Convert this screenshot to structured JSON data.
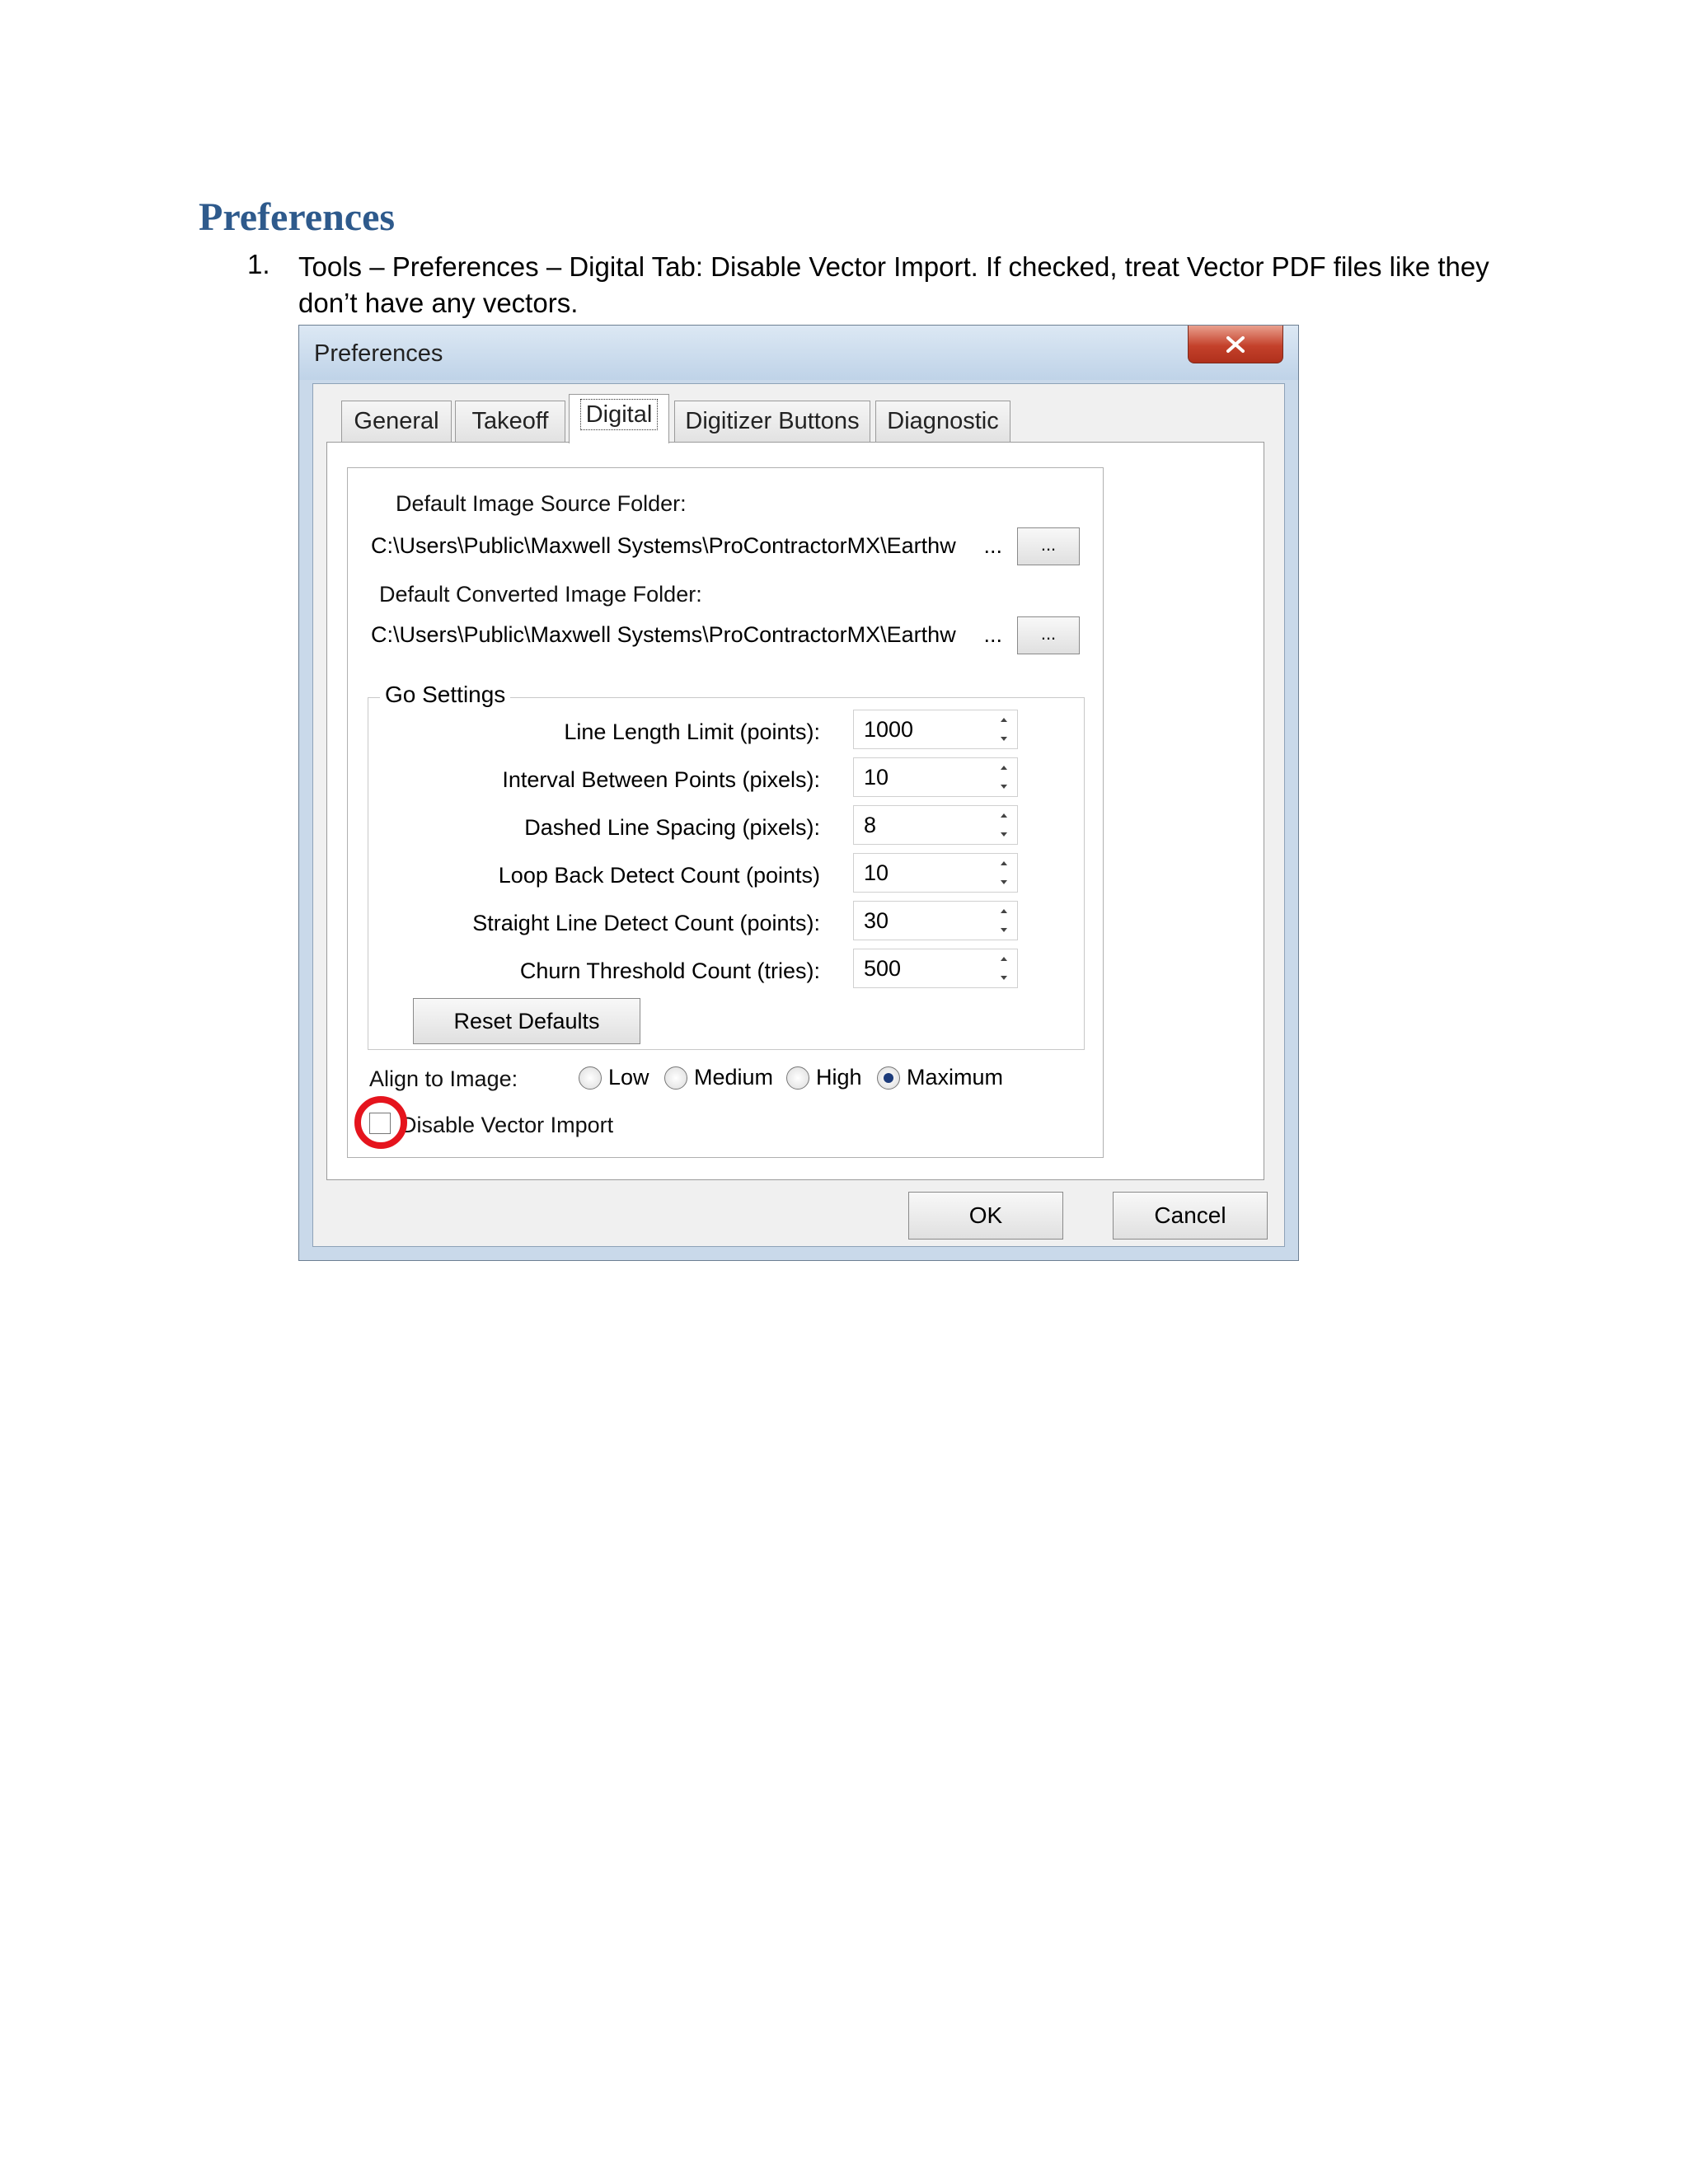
{
  "document": {
    "heading": "Preferences",
    "list_number": "1.",
    "instruction": "Tools – Preferences – Digital Tab: Disable Vector Import.  If checked, treat Vector PDF files like they don’t have any vectors."
  },
  "dialog": {
    "title": "Preferences",
    "tabs": [
      {
        "label": "General",
        "active": false
      },
      {
        "label": "Takeoff",
        "active": false
      },
      {
        "label": "Digital",
        "active": true
      },
      {
        "label": "Digitizer Buttons",
        "active": false
      },
      {
        "label": "Diagnostic",
        "active": false
      }
    ],
    "source_folder_label": "Default Image Source Folder:",
    "source_folder_value": "C:\\Users\\Public\\Maxwell Systems\\ProContractorMX\\Earthw",
    "converted_folder_label": "Default Converted Image Folder:",
    "converted_folder_value": "C:\\Users\\Public\\Maxwell Systems\\ProContractorMX\\Earthw",
    "ellipsis": "...",
    "browse_label": "...",
    "go_settings": {
      "title": "Go Settings",
      "rows": [
        {
          "label": "Line Length Limit (points):",
          "value": "1000"
        },
        {
          "label": "Interval Between Points (pixels):",
          "value": "10"
        },
        {
          "label": "Dashed Line Spacing (pixels):",
          "value": "8"
        },
        {
          "label": "Loop Back Detect Count (points)",
          "value": "10"
        },
        {
          "label": "Straight Line Detect Count (points):",
          "value": "30"
        },
        {
          "label": "Churn Threshold Count (tries):",
          "value": "500"
        }
      ],
      "reset_label": "Reset Defaults"
    },
    "align_label": "Align to Image:",
    "align_options": [
      {
        "label": "Low",
        "selected": false
      },
      {
        "label": "Medium",
        "selected": false
      },
      {
        "label": "High",
        "selected": false
      },
      {
        "label": "Maximum",
        "selected": true
      }
    ],
    "disable_vector_label": "Disable Vector Import",
    "disable_vector_checked": false,
    "ok_label": "OK",
    "cancel_label": "Cancel",
    "highlight_color": "#e5141d"
  }
}
